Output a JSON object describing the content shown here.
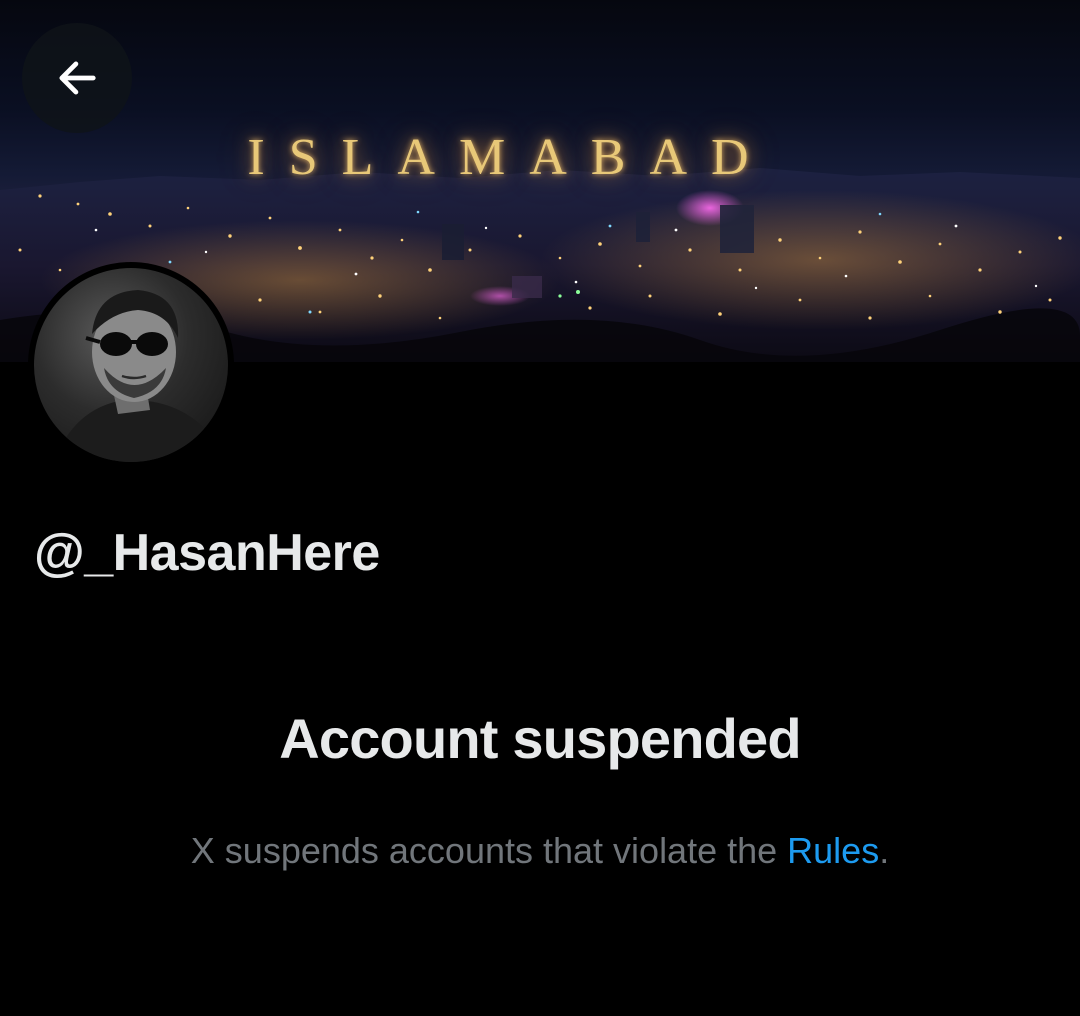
{
  "header": {
    "back_icon": "arrow-left-icon",
    "banner_text": "ISLAMABAD"
  },
  "profile": {
    "handle": "@_HasanHere"
  },
  "suspension": {
    "title": "Account suspended",
    "message_prefix": "X suspends accounts that violate the ",
    "rules_link": "Rules",
    "message_suffix": "."
  },
  "colors": {
    "background": "#000000",
    "primary_text": "#e7e9ea",
    "secondary_text": "#71767b",
    "link": "#1d9bf0",
    "banner_gold": "#e8c878"
  }
}
